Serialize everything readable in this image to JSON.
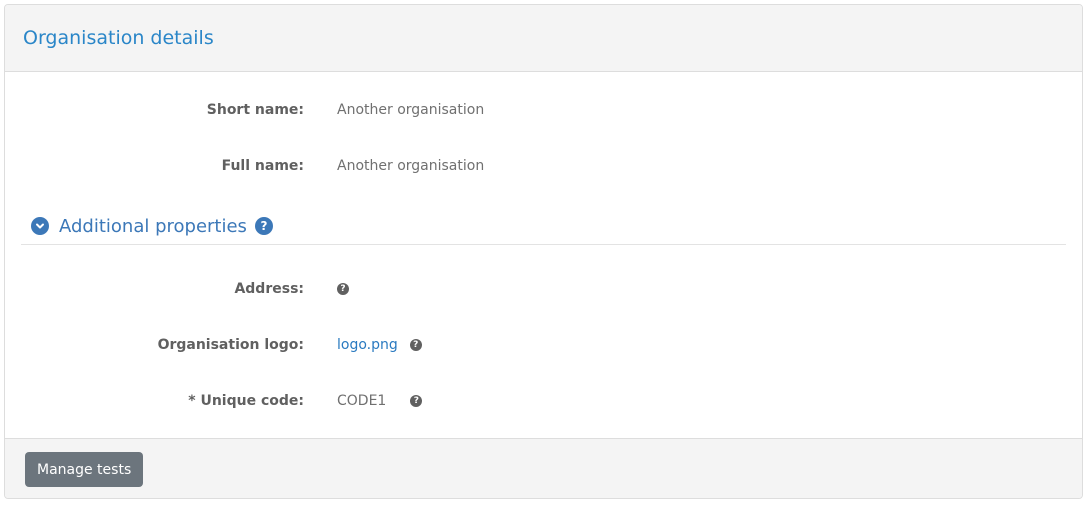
{
  "panel": {
    "title": "Organisation details"
  },
  "fields": {
    "short_name": {
      "label": "Short name:",
      "value": "Another organisation"
    },
    "full_name": {
      "label": "Full name:",
      "value": "Another organisation"
    }
  },
  "additional": {
    "title": "Additional properties",
    "expand_icon": "chevron-down-circle-icon",
    "help_icon": "question-circle-icon",
    "address": {
      "label": "Address:",
      "value": ""
    },
    "logo": {
      "label": "Organisation logo:",
      "value": "logo.png"
    },
    "unique_code": {
      "label": "* Unique code:",
      "value": "CODE1"
    }
  },
  "footer": {
    "manage_tests_label": "Manage tests"
  },
  "colors": {
    "title_blue": "#2a86c8",
    "section_blue": "#3c78b8",
    "link_blue": "#2a7ac0",
    "button_gray": "#6c757d"
  }
}
